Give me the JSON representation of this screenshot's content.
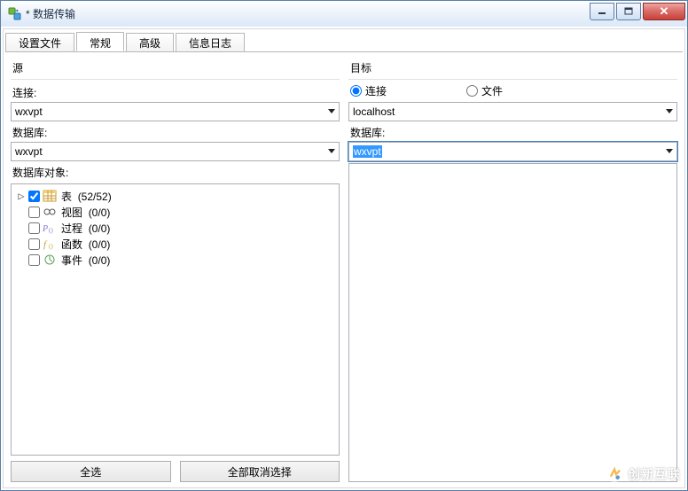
{
  "window": {
    "title": "* 数据传输"
  },
  "tabs": [
    {
      "label": "设置文件"
    },
    {
      "label": "常规"
    },
    {
      "label": "高级"
    },
    {
      "label": "信息日志"
    }
  ],
  "active_tab": 1,
  "source": {
    "group_label": "源",
    "connection_label": "连接:",
    "connection_value": "wxvpt",
    "database_label": "数据库:",
    "database_value": "wxvpt",
    "objects_label": "数据库对象:",
    "tree": [
      {
        "label": "表",
        "count": "(52/52)",
        "type": "table",
        "checked": true,
        "expandable": true
      },
      {
        "label": "视图",
        "count": "(0/0)",
        "type": "view",
        "checked": false,
        "expandable": false
      },
      {
        "label": "过程",
        "count": "(0/0)",
        "type": "proc",
        "checked": false,
        "expandable": false
      },
      {
        "label": "函数",
        "count": "(0/0)",
        "type": "func",
        "checked": false,
        "expandable": false
      },
      {
        "label": "事件",
        "count": "(0/0)",
        "type": "event",
        "checked": false,
        "expandable": false
      }
    ],
    "select_all": "全选",
    "deselect_all": "全部取消选择"
  },
  "target": {
    "group_label": "目标",
    "radio_connection": "连接",
    "radio_file": "文件",
    "radio_selected": "connection",
    "connection_value": "localhost",
    "database_label": "数据库:",
    "database_value": "wxvpt"
  },
  "watermark": {
    "text": "创新互联"
  }
}
